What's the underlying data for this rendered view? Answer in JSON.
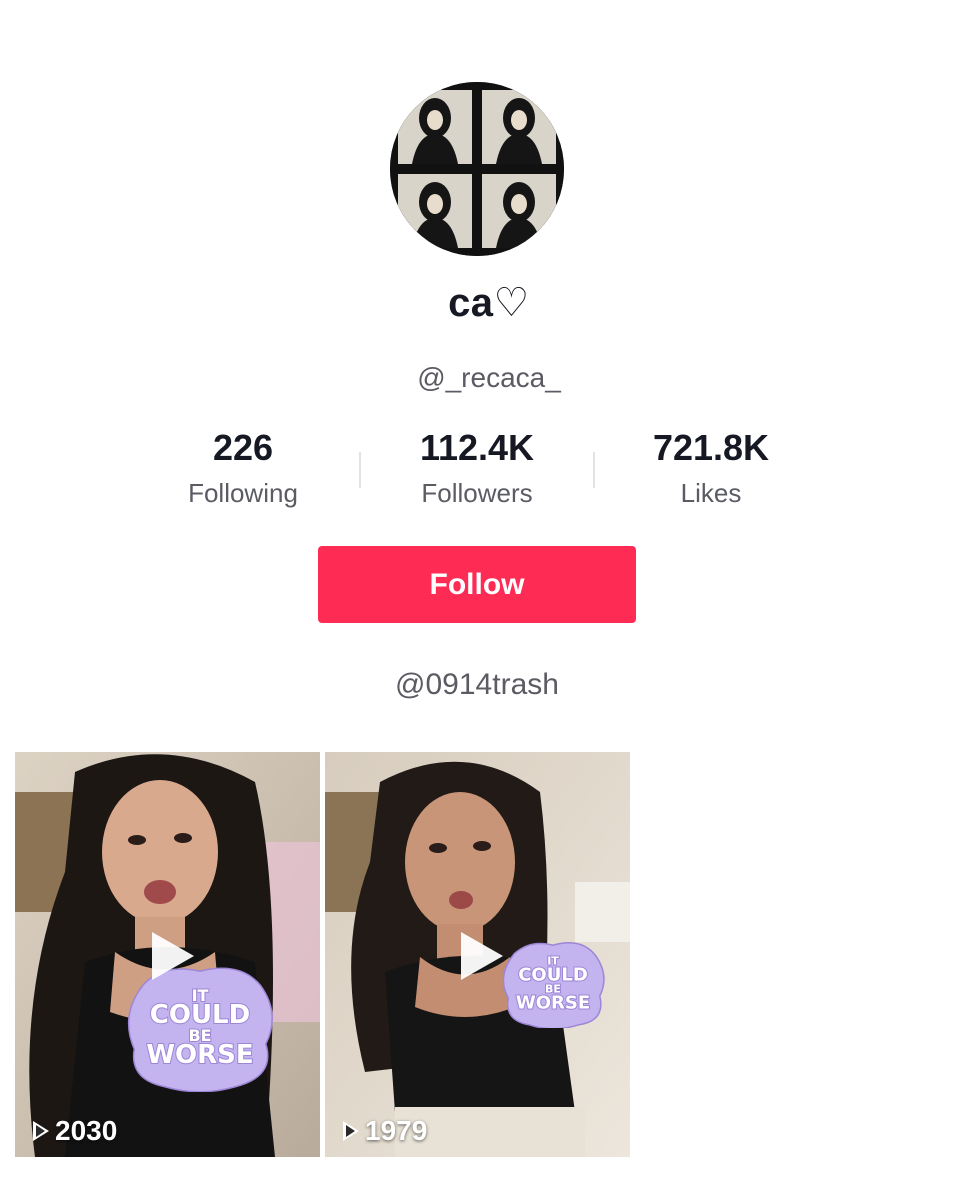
{
  "profile": {
    "display_name": "ca♡",
    "handle": "@_recaca_",
    "bio": "@0914trash"
  },
  "stats": {
    "following": {
      "value": "226",
      "label": "Following"
    },
    "followers": {
      "value": "112.4K",
      "label": "Followers"
    },
    "likes": {
      "value": "721.8K",
      "label": "Likes"
    }
  },
  "actions": {
    "follow_label": "Follow"
  },
  "videos": [
    {
      "views": "2030",
      "sticker_lines": [
        "IT",
        "COULD",
        "BE",
        "WORSE"
      ]
    },
    {
      "views": "1979",
      "sticker_lines": [
        "IT",
        "COULD",
        "BE",
        "WORSE"
      ]
    }
  ],
  "colors": {
    "accent": "#fe2c55",
    "text_primary": "#161823",
    "text_secondary": "#5b5c63",
    "divider": "#e3e3e4",
    "sticker_purple": "#9d86d6"
  },
  "icons": {
    "play": "play-icon",
    "views": "play-outline-icon"
  }
}
